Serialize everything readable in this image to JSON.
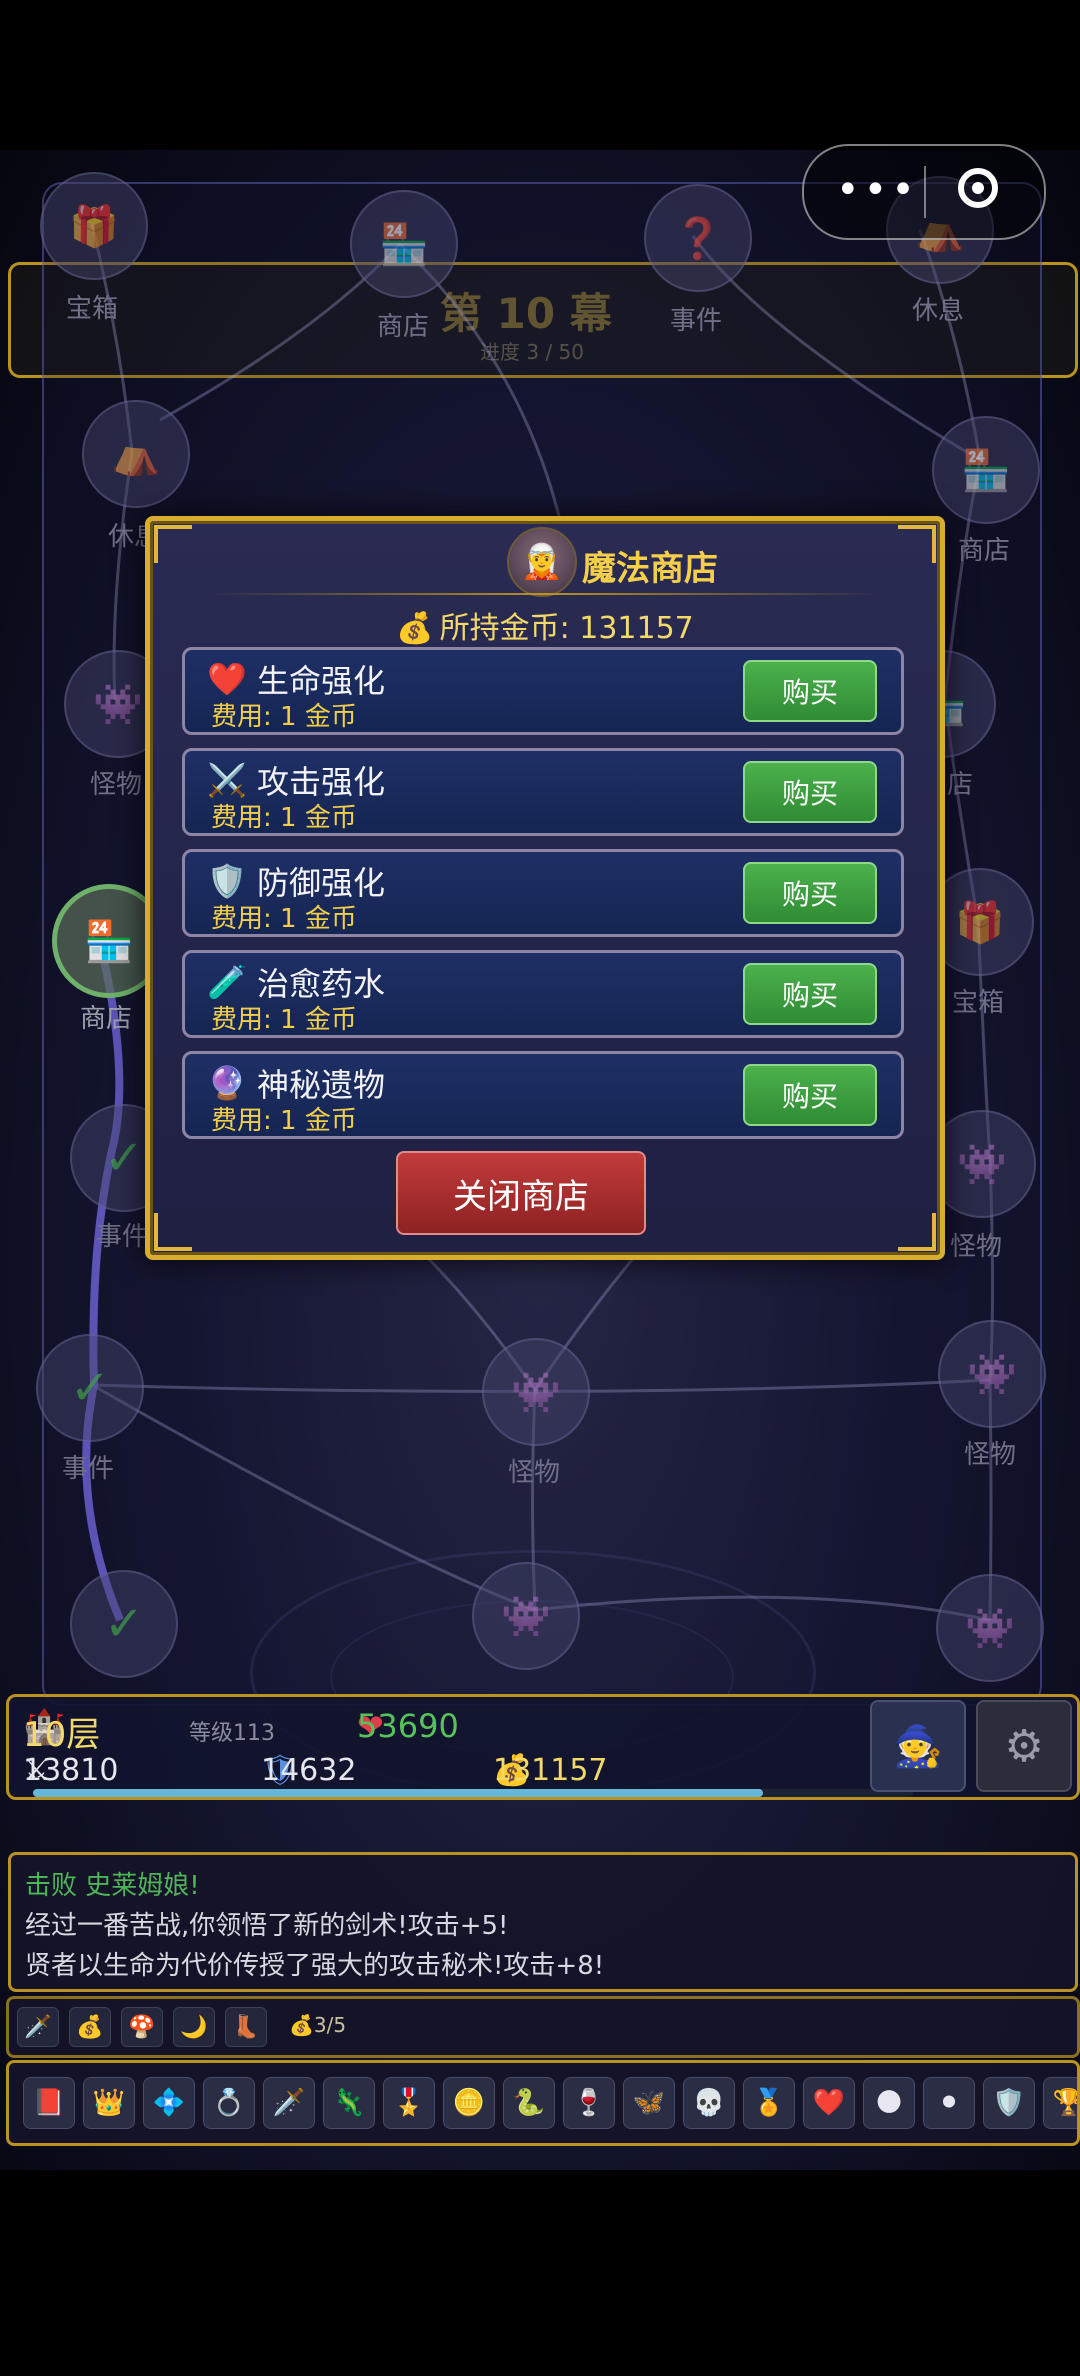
{
  "act": {
    "title": "第 10 幕",
    "progress": "进度 3 / 50"
  },
  "map_nodes": [
    {
      "label": "宝箱",
      "icon": "🎁"
    },
    {
      "label": "商店",
      "icon": "🏪"
    },
    {
      "label": "事件",
      "icon": "❓"
    },
    {
      "label": "休息",
      "icon": "⛺"
    },
    {
      "label": "休息",
      "icon": "⛺"
    },
    {
      "label": "商店",
      "icon": "🏪"
    },
    {
      "label": "怪物",
      "icon": "👾"
    },
    {
      "label": "店",
      "icon": "🏪"
    },
    {
      "label": "商店",
      "icon": "🏪"
    },
    {
      "label": "宝箱",
      "icon": "🎁"
    },
    {
      "label": "事件",
      "icon": "✓"
    },
    {
      "label": "怪物",
      "icon": "👾"
    },
    {
      "label": "事件",
      "icon": "✓"
    },
    {
      "label": "怪物",
      "icon": "👾"
    },
    {
      "label": "怪物",
      "icon": "👾"
    },
    {
      "label": "",
      "icon": "✓"
    },
    {
      "label": "",
      "icon": "👾"
    },
    {
      "label": "",
      "icon": "👾"
    }
  ],
  "shop": {
    "title": "魔法商店",
    "gold_label": "所持金币: 131157",
    "items": [
      {
        "icon": "❤️",
        "name": "生命强化",
        "cost": "费用: 1 金币",
        "buy": "购买"
      },
      {
        "icon": "⚔️",
        "name": "攻击强化",
        "cost": "费用: 1 金币",
        "buy": "购买"
      },
      {
        "icon": "🛡️",
        "name": "防御强化",
        "cost": "费用: 1 金币",
        "buy": "购买"
      },
      {
        "icon": "🧪",
        "name": "治愈药水",
        "cost": "费用: 1 金币",
        "buy": "购买"
      },
      {
        "icon": "🔮",
        "name": "神秘遗物",
        "cost": "费用: 1 金币",
        "buy": "购买"
      }
    ],
    "close": "关闭商店"
  },
  "hud": {
    "floor": "10层",
    "level": "等级113",
    "hp": "53690",
    "attack": "13810",
    "defense": "14632",
    "gold": "131157",
    "xp_fraction": 0.83
  },
  "log": {
    "line1": "击败 史莱姆娘!",
    "line2": "经过一番苦战,你领悟了新的剑术!攻击+5!",
    "line3": "贤者以生命为代价传授了强大的攻击秘术!攻击+8!"
  },
  "effects": {
    "icons": [
      "🗡️",
      "💰",
      "🍄",
      "🌙",
      "👢"
    ],
    "count": "3/5"
  },
  "relics": [
    "📕",
    "👑",
    "💠",
    "💍",
    "🗡️",
    "🦎",
    "🎖️",
    "🪙",
    "🐍",
    "🍷",
    "🦋",
    "💀",
    "🏅",
    "❤️",
    "🌑",
    "⚫",
    "🛡️",
    "🏆"
  ]
}
